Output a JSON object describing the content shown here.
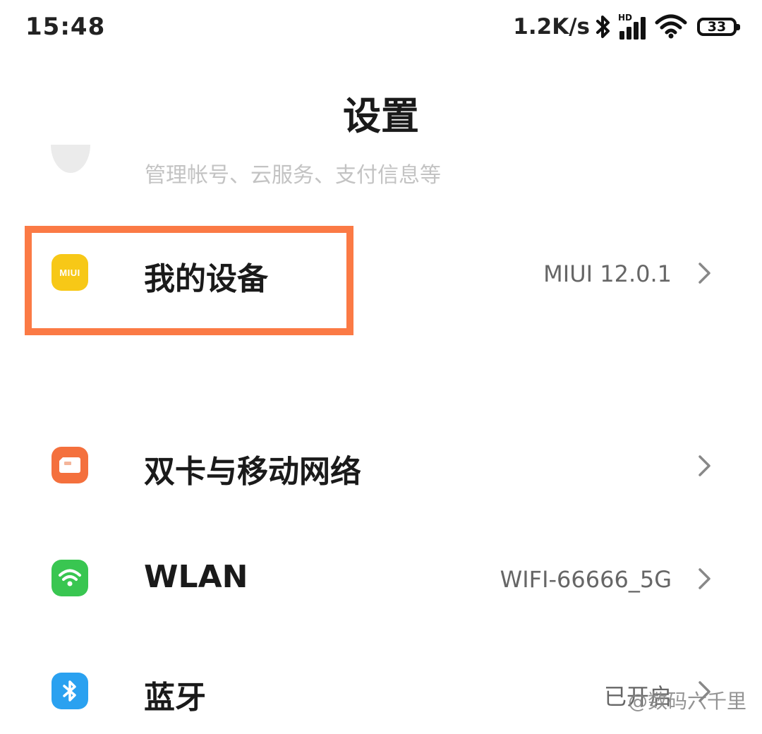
{
  "status_bar": {
    "time": "15:48",
    "net_speed": "1.2K/s",
    "hd_label": "HD",
    "battery_level": "33"
  },
  "header": {
    "title": "设置"
  },
  "account_row": {
    "subtitle": "管理帐号、云服务、支付信息等"
  },
  "rows": [
    {
      "label": "我的设备",
      "value": "MIUI 12.0.1",
      "icon": "miui-icon",
      "icon_text": "MIUI",
      "icon_color": "#f7c817"
    },
    {
      "label": "双卡与移动网络",
      "value": "",
      "icon": "sim-card-icon",
      "icon_color": "#f4703d"
    },
    {
      "label": "WLAN",
      "value": "WIFI-66666_5G",
      "icon": "wifi-icon",
      "icon_color": "#39c651"
    },
    {
      "label": "蓝牙",
      "value": "已开启",
      "icon": "bluetooth-icon",
      "icon_color": "#2aa1f0"
    }
  ],
  "highlight_color": "#fb7a45",
  "watermark": "@数码六千里"
}
